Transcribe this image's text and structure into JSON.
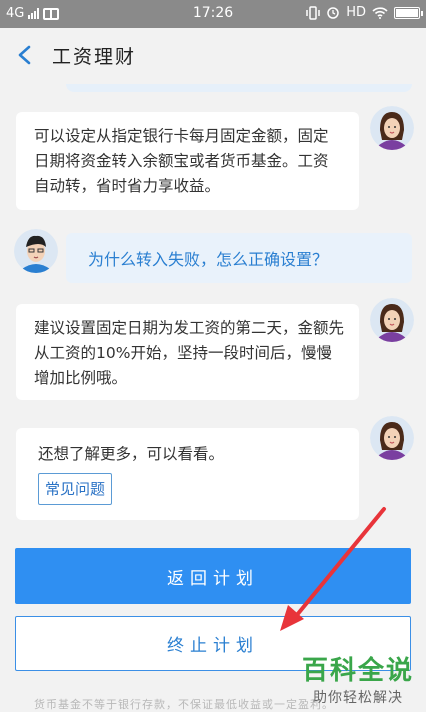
{
  "status_bar": {
    "network": "4G",
    "time": "17:26",
    "hd_label": "HD"
  },
  "nav": {
    "title": "工资理财"
  },
  "messages": [
    {
      "from": "assistant",
      "text": "可以设定从指定银行卡每月固定金额，固定日期将资金转入余额宝或者货币基金。工资自动转，省时省力享收益。"
    },
    {
      "from": "user",
      "text": "为什么转入失败，怎么正确设置？"
    },
    {
      "from": "assistant",
      "text": "建议设置固定日期为发工资的第二天，金额先从工资的10%开始，坚持一段时间后，慢慢增加比例哦。"
    },
    {
      "from": "assistant",
      "text": "还想了解更多，可以看看。",
      "link_label": "常见问题"
    }
  ],
  "buttons": {
    "return_plan": "返回计划",
    "stop_plan": "终止计划"
  },
  "disclaimer": "货币基金不等于银行存款，不保证最低收益或一定盈利。",
  "watermark": {
    "main": "百科全说",
    "sub": "助你轻松解决"
  },
  "colors": {
    "primary": "#2f8ff2",
    "status_bar": "#8a8a8a",
    "annotation_arrow": "#e8343a",
    "watermark_green": "#3aa64a"
  }
}
